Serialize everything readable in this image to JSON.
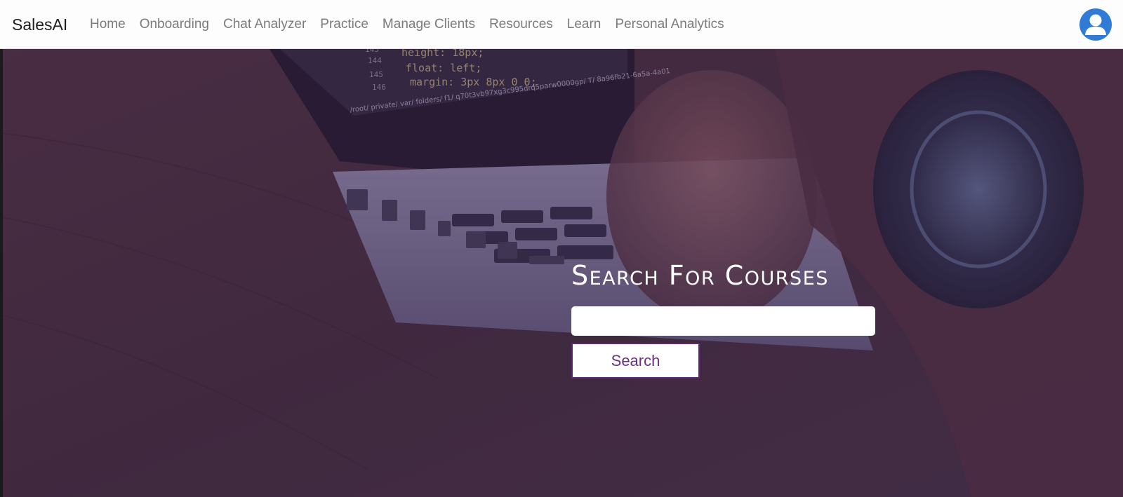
{
  "navbar": {
    "brand": "SalesAI",
    "links": [
      {
        "label": "Home"
      },
      {
        "label": "Onboarding"
      },
      {
        "label": "Chat Analyzer"
      },
      {
        "label": "Practice"
      },
      {
        "label": "Manage Clients"
      },
      {
        "label": "Resources"
      },
      {
        "label": "Learn"
      },
      {
        "label": "Personal Analytics"
      }
    ],
    "avatar_icon": "user-avatar-icon"
  },
  "hero": {
    "title": "Search For Courses",
    "search_placeholder": "",
    "search_value": "",
    "search_button_label": "Search",
    "image_text": {
      "code_line_1": "height: 18px;",
      "code_line_2": "float: left;",
      "code_line_3": "margin: 3px 8px 0 0;",
      "line_numbers": [
        "143",
        "144",
        "145",
        "146"
      ],
      "path_text": "/root/ private/ var/ folders/ f1/ q70t3vb97xg3c995drq5parw0000gp/ T/ 8a96fb21-6a5a-4a01"
    }
  },
  "colors": {
    "accent": "#6b2e83",
    "avatar": "#2f7bd6",
    "nav_text": "#7b7b7b",
    "hero_overlay": "#46285a"
  }
}
